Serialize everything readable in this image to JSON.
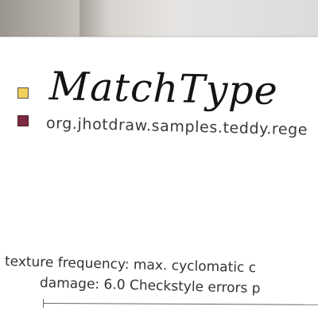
{
  "card": {
    "title": "MatchType",
    "package": "org.jhotdraw.samples.teddy.rege",
    "metrics_line1": "texture frequency: max. cyclomatic c",
    "metrics_line2": "damage: 6.0 Checkstyle errors p"
  },
  "legend": {
    "swatch_colors": [
      "#f2cf5a",
      "#7b2a3f"
    ]
  }
}
